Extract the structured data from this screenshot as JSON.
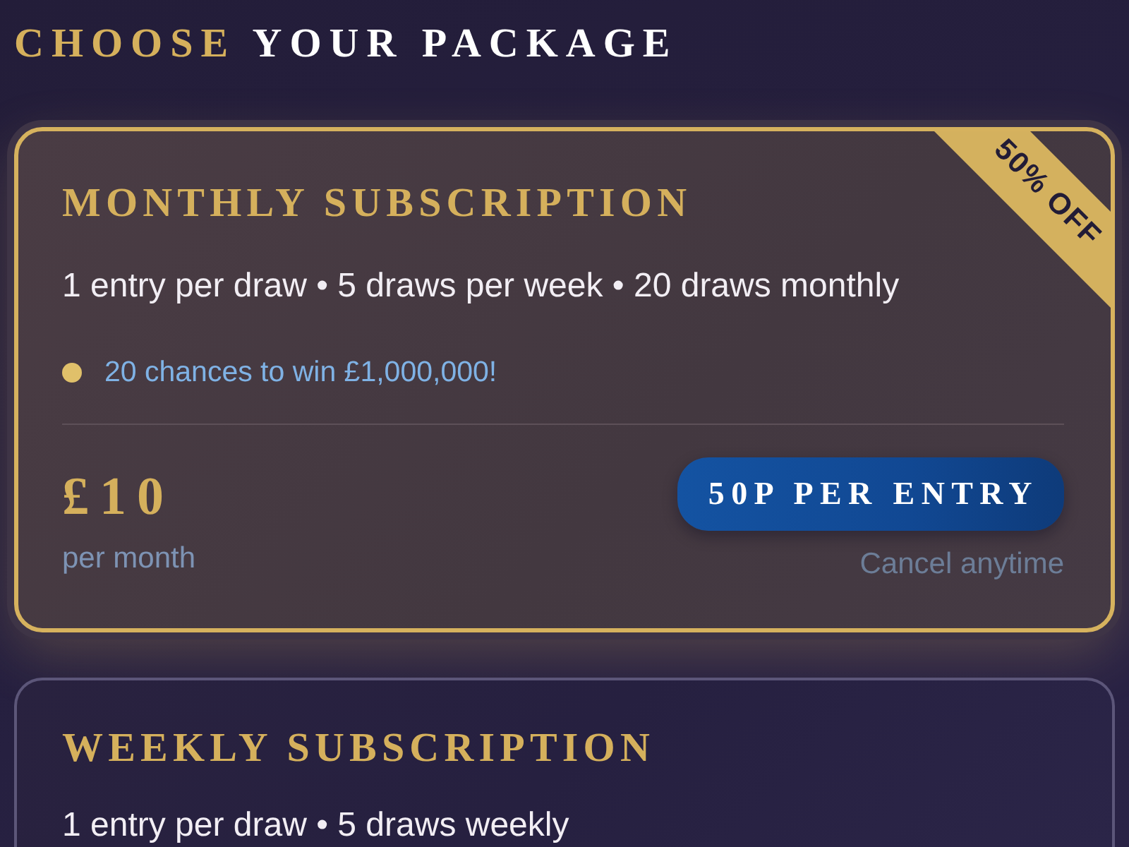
{
  "title": {
    "accent": "CHOOSE",
    "text": "YOUR PACKAGE"
  },
  "packages": [
    {
      "title": "MONTHLY SUBSCRIPTION",
      "selected": true,
      "badge": "50% OFF",
      "features": "1 entry per draw • 5 draws per week • 20 draws monthly",
      "highlight": "20 chances to win £1,000,000!",
      "price": "£10",
      "period": "per month",
      "per_entry": "50P PER ENTRY",
      "note": "Cancel anytime"
    },
    {
      "title": "WEEKLY SUBSCRIPTION",
      "selected": false,
      "features": "1 entry per draw • 5 draws weekly"
    }
  ]
}
